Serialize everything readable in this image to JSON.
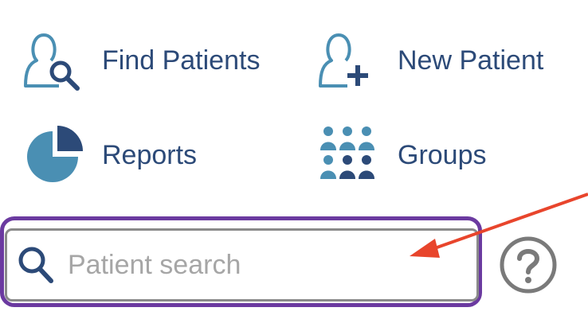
{
  "nav": {
    "find_patients": {
      "label": "Find Patients",
      "icon": "find-patients-icon"
    },
    "new_patient": {
      "label": "New Patient",
      "icon": "new-patient-icon"
    },
    "reports": {
      "label": "Reports",
      "icon": "reports-pie-icon"
    },
    "groups": {
      "label": "Groups",
      "icon": "groups-icon"
    }
  },
  "search": {
    "placeholder": "Patient search",
    "value": "",
    "icon": "search-icon"
  },
  "help": {
    "icon": "help-question-icon"
  },
  "colors": {
    "label_text": "#2c4a78",
    "icon_teal": "#4a8fb3",
    "icon_navy": "#2c4a78",
    "highlight_frame": "#6b3aa0",
    "input_border": "#8a8a8a",
    "placeholder": "#a6a6a6",
    "help_icon": "#7a7a7a",
    "arrow": "#e8452c"
  }
}
